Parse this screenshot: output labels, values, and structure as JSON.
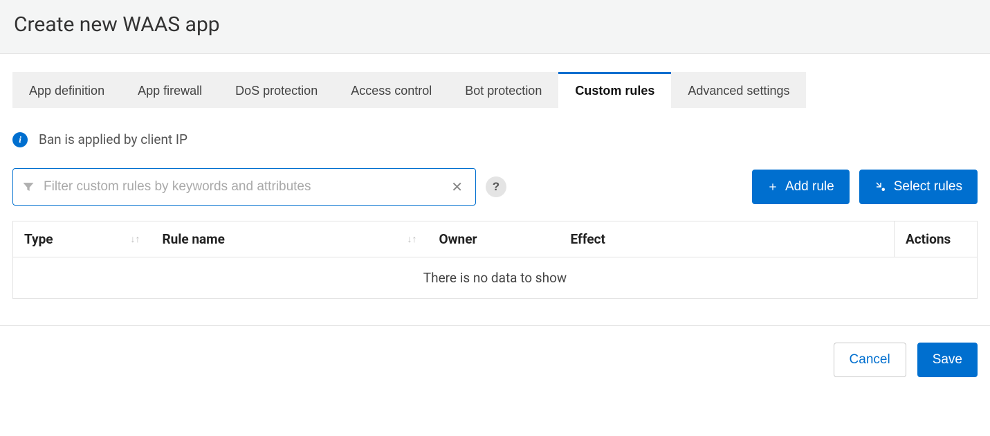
{
  "header": {
    "title": "Create new WAAS app"
  },
  "tabs": [
    {
      "id": "app-definition",
      "label": "App definition",
      "active": false
    },
    {
      "id": "app-firewall",
      "label": "App firewall",
      "active": false
    },
    {
      "id": "dos-protection",
      "label": "DoS protection",
      "active": false
    },
    {
      "id": "access-control",
      "label": "Access control",
      "active": false
    },
    {
      "id": "bot-protection",
      "label": "Bot protection",
      "active": false
    },
    {
      "id": "custom-rules",
      "label": "Custom rules",
      "active": true
    },
    {
      "id": "advanced-settings",
      "label": "Advanced settings",
      "active": false
    }
  ],
  "info": {
    "text": "Ban is applied by client IP"
  },
  "filter": {
    "placeholder": "Filter custom rules by keywords and attributes",
    "value": ""
  },
  "actions": {
    "add_rule": "Add rule",
    "select_rules": "Select rules"
  },
  "table": {
    "columns": {
      "type": "Type",
      "rule_name": "Rule name",
      "owner": "Owner",
      "effect": "Effect",
      "actions": "Actions"
    },
    "empty_message": "There is no data to show",
    "rows": []
  },
  "footer": {
    "cancel": "Cancel",
    "save": "Save"
  }
}
